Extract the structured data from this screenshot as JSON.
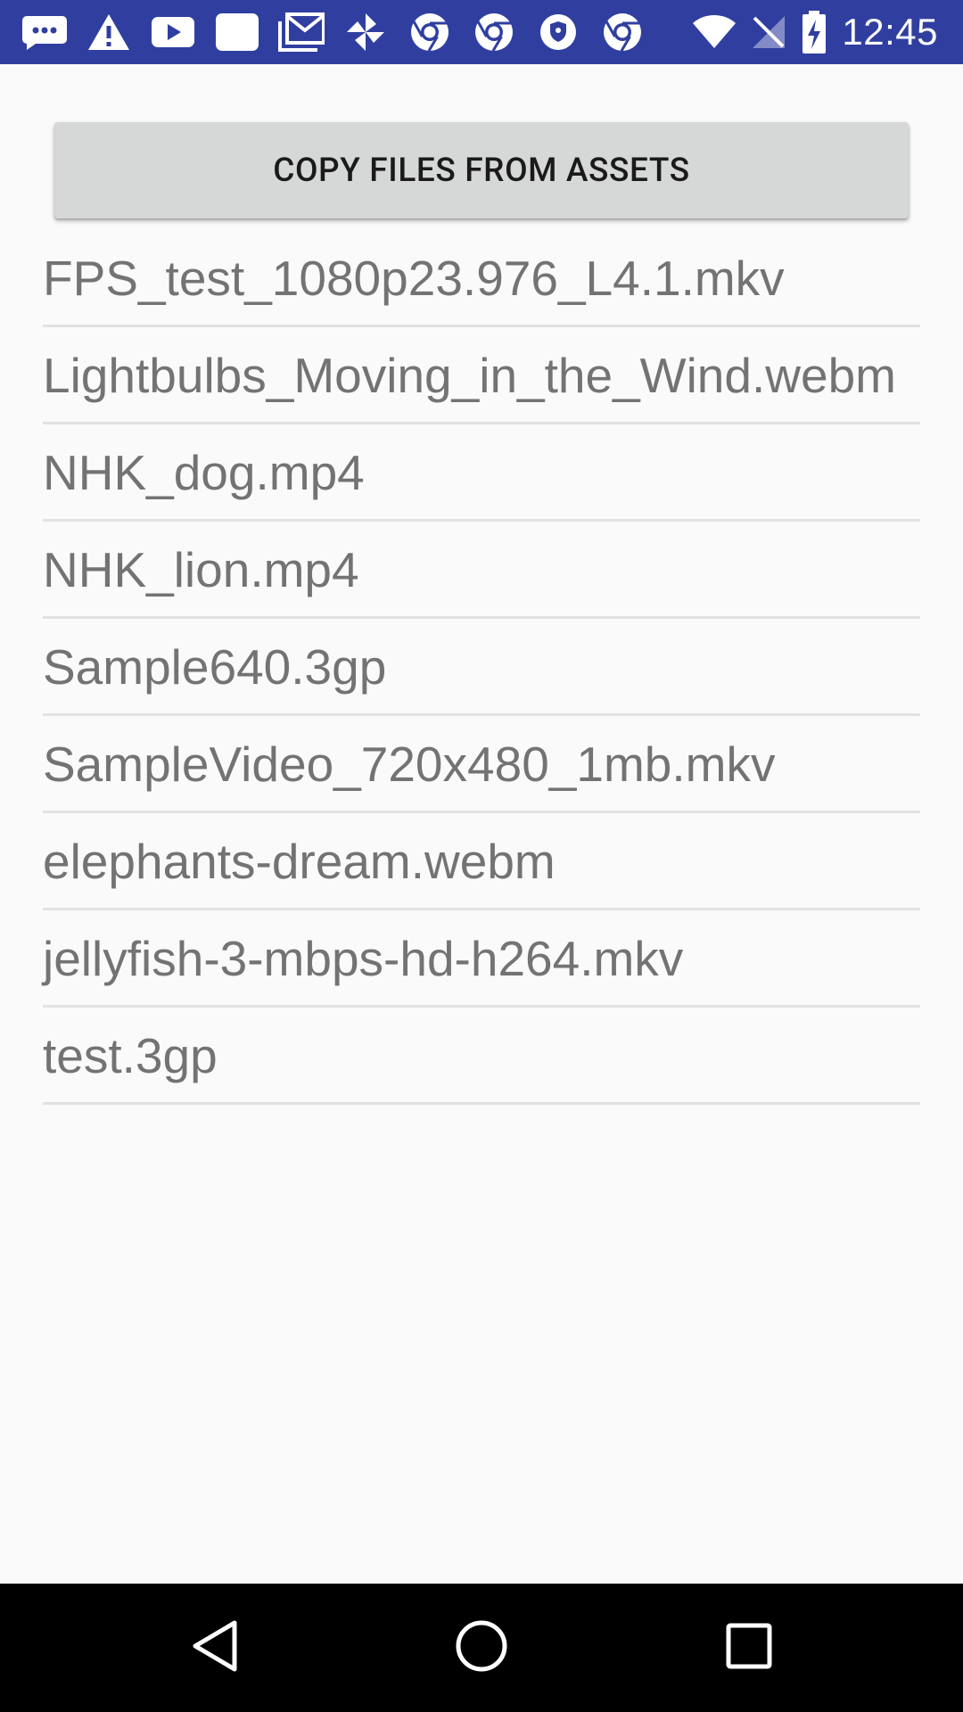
{
  "status_bar": {
    "time": "12:45",
    "bg_color": "#303f9f",
    "notification_icons": [
      "messages-icon",
      "warning-icon",
      "youtube-icon",
      "blank-app-icon",
      "gmail-icon",
      "pinwheel-icon",
      "chrome-icon",
      "chrome-icon",
      "shield-icon",
      "chrome-icon"
    ],
    "system_icons": [
      "wifi-icon",
      "no-signal-icon",
      "battery-charging-icon"
    ]
  },
  "toolbar": {
    "copy_label": "COPY FILES FROM ASSETS"
  },
  "files": [
    {
      "name": "FPS_test_1080p23.976_L4.1.mkv"
    },
    {
      "name": "Lightbulbs_Moving_in_the_Wind.webm"
    },
    {
      "name": "NHK_dog.mp4"
    },
    {
      "name": "NHK_lion.mp4"
    },
    {
      "name": "Sample640.3gp"
    },
    {
      "name": "SampleVideo_720x480_1mb.mkv"
    },
    {
      "name": "elephants-dream.webm"
    },
    {
      "name": "jellyfish-3-mbps-hd-h264.mkv"
    },
    {
      "name": "test.3gp"
    }
  ],
  "nav_bar": {
    "icons": [
      "back-icon",
      "home-icon",
      "recents-icon"
    ]
  }
}
